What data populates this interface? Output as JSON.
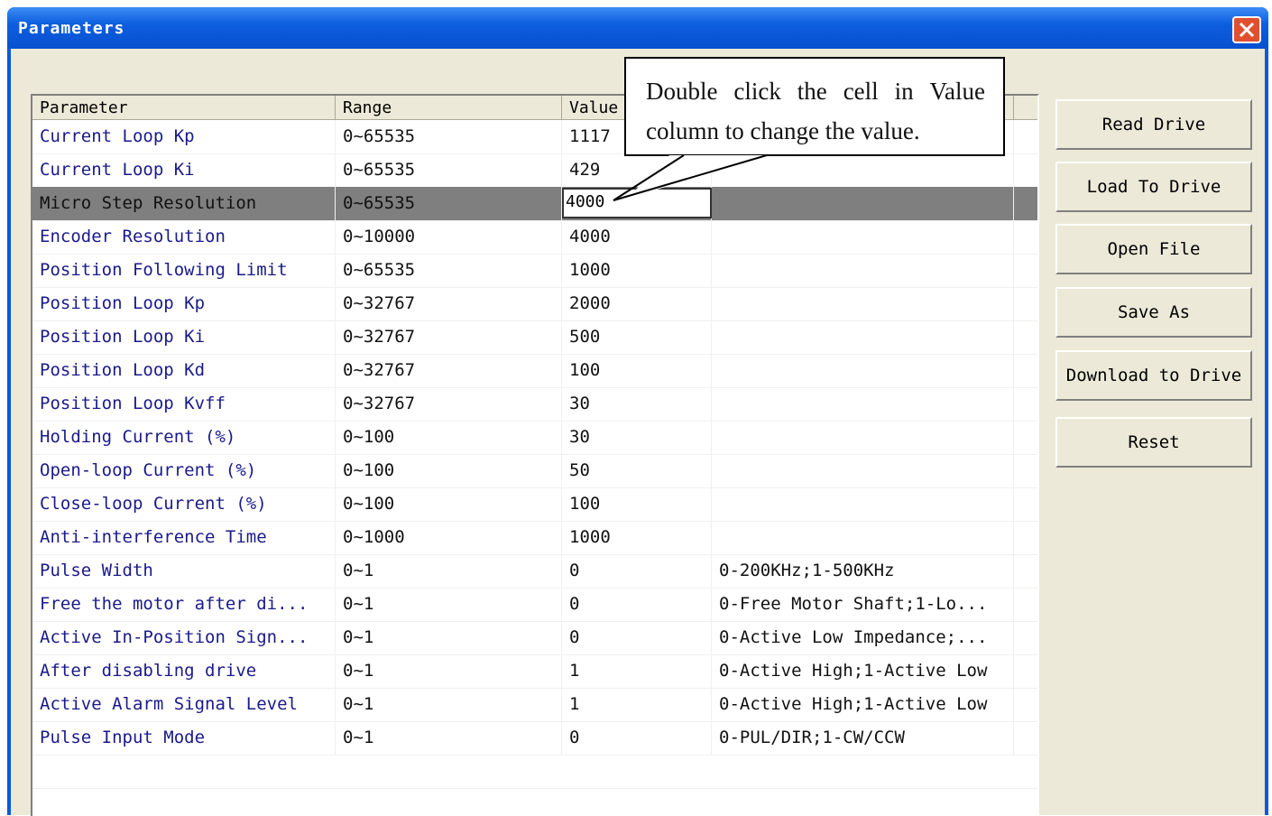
{
  "window": {
    "title": "Parameters"
  },
  "table": {
    "headers": [
      "Parameter",
      "Range",
      "Value",
      ""
    ],
    "rows": [
      {
        "name": "Current Loop Kp",
        "range": "0~65535",
        "value": "1117",
        "desc": ""
      },
      {
        "name": "Current Loop Ki",
        "range": "0~65535",
        "value": "429",
        "desc": ""
      },
      {
        "name": "Micro Step Resolution",
        "range": "0~65535",
        "value": "",
        "desc": "",
        "selected": true
      },
      {
        "name": "Encoder Resolution",
        "range": "0~10000",
        "value": "4000",
        "desc": ""
      },
      {
        "name": "Position Following Limit",
        "range": "0~65535",
        "value": "1000",
        "desc": ""
      },
      {
        "name": "Position Loop Kp",
        "range": "0~32767",
        "value": "2000",
        "desc": ""
      },
      {
        "name": "Position Loop Ki",
        "range": "0~32767",
        "value": "500",
        "desc": ""
      },
      {
        "name": "Position Loop Kd",
        "range": "0~32767",
        "value": "100",
        "desc": ""
      },
      {
        "name": "Position Loop Kvff",
        "range": "0~32767",
        "value": "30",
        "desc": ""
      },
      {
        "name": "Holding Current (%)",
        "range": "0~100",
        "value": "30",
        "desc": ""
      },
      {
        "name": "Open-loop Current (%)",
        "range": "0~100",
        "value": "50",
        "desc": ""
      },
      {
        "name": "Close-loop Current (%)",
        "range": "0~100",
        "value": "100",
        "desc": ""
      },
      {
        "name": "Anti-interference Time",
        "range": "0~1000",
        "value": "1000",
        "desc": ""
      },
      {
        "name": "Pulse Width",
        "range": "0~1",
        "value": "0",
        "desc": "0-200KHz;1-500KHz"
      },
      {
        "name": "Free the motor after di...",
        "range": "0~1",
        "value": "0",
        "desc": "0-Free Motor Shaft;1-Lo..."
      },
      {
        "name": "Active In-Position Sign...",
        "range": "0~1",
        "value": "0",
        "desc": "0-Active Low Impedance;..."
      },
      {
        "name": "After disabling drive",
        "range": "0~1",
        "value": "1",
        "desc": "0-Active High;1-Active Low"
      },
      {
        "name": "Active Alarm Signal Level",
        "range": "0~1",
        "value": "1",
        "desc": "0-Active High;1-Active Low"
      },
      {
        "name": "Pulse Input Mode",
        "range": "0~1",
        "value": "0",
        "desc": "0-PUL/DIR;1-CW/CCW"
      }
    ],
    "edit_value": "4000"
  },
  "buttons": {
    "read_drive": "Read Drive",
    "load_to_drive": "Load To Drive",
    "open_file": "Open File",
    "save_as": "Save As",
    "download_to_drive": "Download to Drive",
    "reset": "Reset"
  },
  "callout": {
    "line1_words": [
      "Double",
      "click",
      "the",
      "cell",
      "in",
      "Value"
    ],
    "line2": "column to change the value."
  }
}
